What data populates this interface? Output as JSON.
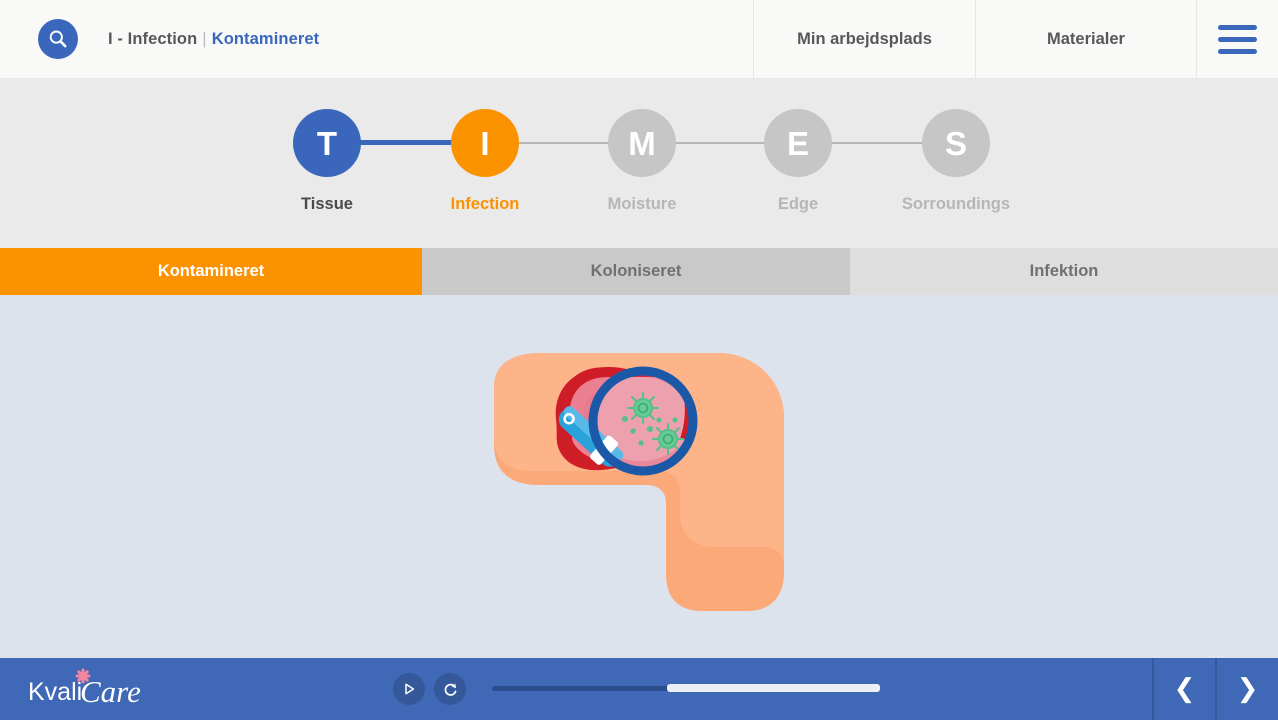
{
  "header": {
    "search_icon": "search-icon",
    "breadcrumb": {
      "parent": "I - Infection",
      "separator": "|",
      "current": "Kontamineret"
    },
    "nav": [
      {
        "label": "Min arbejdsplads"
      },
      {
        "label": "Materialer"
      }
    ],
    "menu_icon": "hamburger-menu-icon"
  },
  "stepper": {
    "steps": [
      {
        "letter": "T",
        "label": "Tissue",
        "state": "done"
      },
      {
        "letter": "I",
        "label": "Infection",
        "state": "current"
      },
      {
        "letter": "M",
        "label": "Moisture",
        "state": "todo"
      },
      {
        "letter": "E",
        "label": "Edge",
        "state": "todo"
      },
      {
        "letter": "S",
        "label": "Sorroundings",
        "state": "todo"
      }
    ]
  },
  "tabs": [
    {
      "label": "Kontamineret",
      "state": "active"
    },
    {
      "label": "Koloniseret",
      "state": "inactive"
    },
    {
      "label": "Infektion",
      "state": "inactive"
    }
  ],
  "illustration": {
    "name": "knee-wound-magnifier-illustration",
    "description": "Bent leg with red wound inspected by a blue magnifying glass revealing green bacteria"
  },
  "player": {
    "logo_text": "KvaliCare",
    "play_icon": "play-icon",
    "replay_icon": "replay-icon",
    "progress_percent": 45,
    "prev_icon": "chevron-left-icon",
    "next_icon": "chevron-right-icon"
  },
  "colors": {
    "brand_blue": "#3a67bb",
    "accent_orange": "#fb9200",
    "player_blue": "#3f68b6",
    "stage_bg": "#dde3ec",
    "band_bg": "#eaeaea",
    "header_bg": "#f9f9f8"
  }
}
